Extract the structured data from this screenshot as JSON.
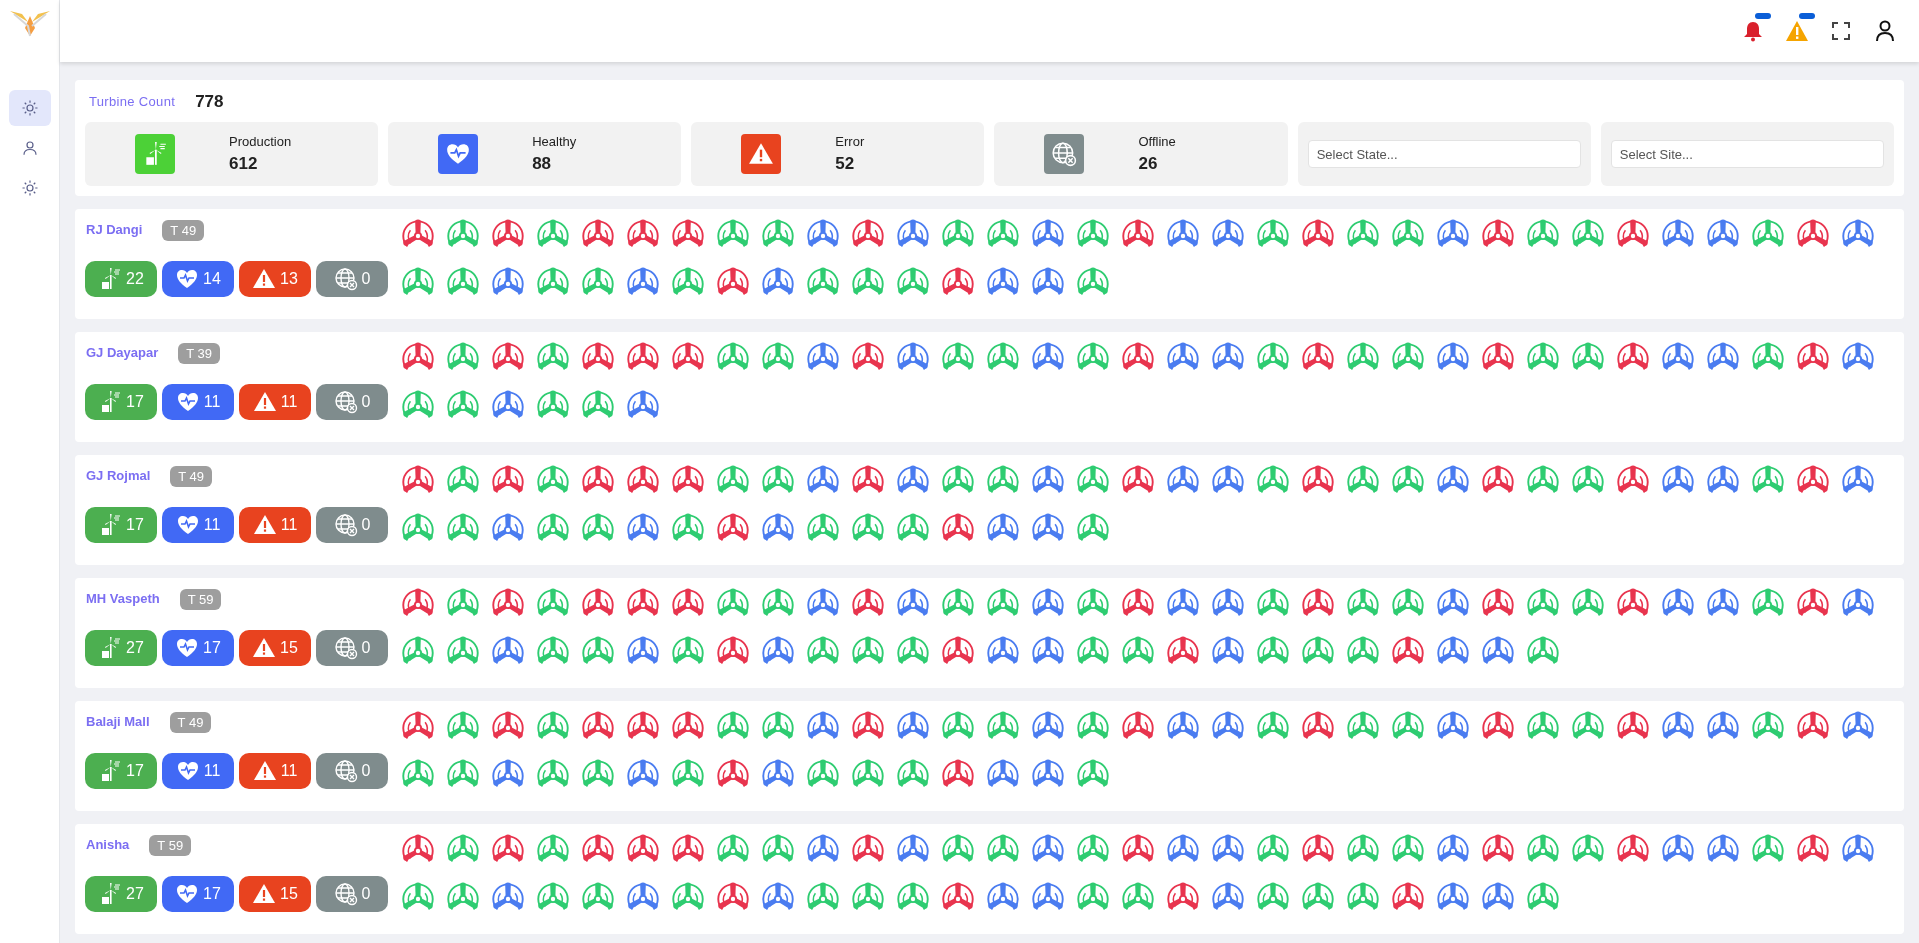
{
  "sidebar": {
    "items": [
      {
        "selected": true
      },
      {
        "selected": false
      },
      {
        "selected": false
      }
    ]
  },
  "summary": {
    "title": "Turbine Count",
    "total": "778",
    "stats": [
      {
        "kind": "production",
        "label": "Production",
        "value": "612"
      },
      {
        "kind": "healthy",
        "label": "Healthy",
        "value": "88"
      },
      {
        "kind": "error",
        "label": "Error",
        "value": "52"
      },
      {
        "kind": "offline",
        "label": "Offline",
        "value": "26"
      }
    ],
    "filters": [
      {
        "placeholder": "Select State..."
      },
      {
        "placeholder": "Select Site..."
      }
    ]
  },
  "sites": [
    {
      "name": "RJ Dangi",
      "count": "T 49",
      "badges": [
        {
          "kind": "production",
          "value": "22"
        },
        {
          "kind": "healthy",
          "value": "14"
        },
        {
          "kind": "error",
          "value": "13"
        },
        {
          "kind": "offline",
          "value": "0"
        }
      ],
      "turbines": [
        {
          "color": "#e8344e"
        },
        {
          "color": "#2ecc71"
        },
        {
          "color": "#e8344e"
        },
        {
          "color": "#2ecc71"
        },
        {
          "color": "#e8344e"
        },
        {
          "color": "#e8344e"
        },
        {
          "color": "#e8344e"
        },
        {
          "color": "#2ecc71"
        },
        {
          "color": "#2ecc71"
        },
        {
          "color": "#4a7cf0"
        },
        {
          "color": "#e8344e"
        },
        {
          "color": "#4a7cf0"
        },
        {
          "color": "#2ecc71"
        },
        {
          "color": "#2ecc71"
        },
        {
          "color": "#4a7cf0"
        },
        {
          "color": "#2ecc71"
        },
        {
          "color": "#e8344e"
        },
        {
          "color": "#4a7cf0"
        },
        {
          "color": "#4a7cf0"
        },
        {
          "color": "#2ecc71"
        },
        {
          "color": "#e8344e"
        },
        {
          "color": "#2ecc71"
        },
        {
          "color": "#2ecc71"
        },
        {
          "color": "#4a7cf0"
        },
        {
          "color": "#e8344e"
        },
        {
          "color": "#2ecc71"
        },
        {
          "color": "#2ecc71"
        },
        {
          "color": "#e8344e"
        },
        {
          "color": "#4a7cf0"
        },
        {
          "color": "#4a7cf0"
        },
        {
          "color": "#2ecc71"
        },
        {
          "color": "#e8344e"
        },
        {
          "color": "#4a7cf0"
        },
        {
          "color": "#2ecc71"
        },
        {
          "color": "#2ecc71"
        },
        {
          "color": "#4a7cf0"
        },
        {
          "color": "#2ecc71"
        },
        {
          "color": "#2ecc71"
        },
        {
          "color": "#4a7cf0"
        },
        {
          "color": "#2ecc71"
        },
        {
          "color": "#e8344e"
        },
        {
          "color": "#4a7cf0"
        },
        {
          "color": "#2ecc71"
        },
        {
          "color": "#2ecc71"
        },
        {
          "color": "#2ecc71"
        },
        {
          "color": "#e8344e"
        },
        {
          "color": "#4a7cf0"
        },
        {
          "color": "#4a7cf0"
        },
        {
          "color": "#2ecc71"
        }
      ]
    },
    {
      "name": "GJ Dayapar",
      "count": "T 39",
      "badges": [
        {
          "kind": "production",
          "value": "17"
        },
        {
          "kind": "healthy",
          "value": "11"
        },
        {
          "kind": "error",
          "value": "11"
        },
        {
          "kind": "offline",
          "value": "0"
        }
      ],
      "turbines": [
        {
          "color": "#e8344e"
        },
        {
          "color": "#2ecc71"
        },
        {
          "color": "#e8344e"
        },
        {
          "color": "#2ecc71"
        },
        {
          "color": "#e8344e"
        },
        {
          "color": "#e8344e"
        },
        {
          "color": "#e8344e"
        },
        {
          "color": "#2ecc71"
        },
        {
          "color": "#2ecc71"
        },
        {
          "color": "#4a7cf0"
        },
        {
          "color": "#e8344e"
        },
        {
          "color": "#4a7cf0"
        },
        {
          "color": "#2ecc71"
        },
        {
          "color": "#2ecc71"
        },
        {
          "color": "#4a7cf0"
        },
        {
          "color": "#2ecc71"
        },
        {
          "color": "#e8344e"
        },
        {
          "color": "#4a7cf0"
        },
        {
          "color": "#4a7cf0"
        },
        {
          "color": "#2ecc71"
        },
        {
          "color": "#e8344e"
        },
        {
          "color": "#2ecc71"
        },
        {
          "color": "#2ecc71"
        },
        {
          "color": "#4a7cf0"
        },
        {
          "color": "#e8344e"
        },
        {
          "color": "#2ecc71"
        },
        {
          "color": "#2ecc71"
        },
        {
          "color": "#e8344e"
        },
        {
          "color": "#4a7cf0"
        },
        {
          "color": "#4a7cf0"
        },
        {
          "color": "#2ecc71"
        },
        {
          "color": "#e8344e"
        },
        {
          "color": "#4a7cf0"
        },
        {
          "color": "#2ecc71"
        },
        {
          "color": "#2ecc71"
        },
        {
          "color": "#4a7cf0"
        },
        {
          "color": "#2ecc71"
        },
        {
          "color": "#2ecc71"
        },
        {
          "color": "#4a7cf0"
        }
      ]
    },
    {
      "name": "GJ Rojmal",
      "count": "T 49",
      "badges": [
        {
          "kind": "production",
          "value": "17"
        },
        {
          "kind": "healthy",
          "value": "11"
        },
        {
          "kind": "error",
          "value": "11"
        },
        {
          "kind": "offline",
          "value": "0"
        }
      ],
      "turbines": [
        {
          "color": "#e8344e"
        },
        {
          "color": "#2ecc71"
        },
        {
          "color": "#e8344e"
        },
        {
          "color": "#2ecc71"
        },
        {
          "color": "#e8344e"
        },
        {
          "color": "#e8344e"
        },
        {
          "color": "#e8344e"
        },
        {
          "color": "#2ecc71"
        },
        {
          "color": "#2ecc71"
        },
        {
          "color": "#4a7cf0"
        },
        {
          "color": "#e8344e"
        },
        {
          "color": "#4a7cf0"
        },
        {
          "color": "#2ecc71"
        },
        {
          "color": "#2ecc71"
        },
        {
          "color": "#4a7cf0"
        },
        {
          "color": "#2ecc71"
        },
        {
          "color": "#e8344e"
        },
        {
          "color": "#4a7cf0"
        },
        {
          "color": "#4a7cf0"
        },
        {
          "color": "#2ecc71"
        },
        {
          "color": "#e8344e"
        },
        {
          "color": "#2ecc71"
        },
        {
          "color": "#2ecc71"
        },
        {
          "color": "#4a7cf0"
        },
        {
          "color": "#e8344e"
        },
        {
          "color": "#2ecc71"
        },
        {
          "color": "#2ecc71"
        },
        {
          "color": "#e8344e"
        },
        {
          "color": "#4a7cf0"
        },
        {
          "color": "#4a7cf0"
        },
        {
          "color": "#2ecc71"
        },
        {
          "color": "#e8344e"
        },
        {
          "color": "#4a7cf0"
        },
        {
          "color": "#2ecc71"
        },
        {
          "color": "#2ecc71"
        },
        {
          "color": "#4a7cf0"
        },
        {
          "color": "#2ecc71"
        },
        {
          "color": "#2ecc71"
        },
        {
          "color": "#4a7cf0"
        },
        {
          "color": "#2ecc71"
        },
        {
          "color": "#e8344e"
        },
        {
          "color": "#4a7cf0"
        },
        {
          "color": "#2ecc71"
        },
        {
          "color": "#2ecc71"
        },
        {
          "color": "#2ecc71"
        },
        {
          "color": "#e8344e"
        },
        {
          "color": "#4a7cf0"
        },
        {
          "color": "#4a7cf0"
        },
        {
          "color": "#2ecc71"
        }
      ]
    },
    {
      "name": "MH Vaspeth",
      "count": "T 59",
      "badges": [
        {
          "kind": "production",
          "value": "27"
        },
        {
          "kind": "healthy",
          "value": "17"
        },
        {
          "kind": "error",
          "value": "15"
        },
        {
          "kind": "offline",
          "value": "0"
        }
      ],
      "turbines": [
        {
          "color": "#e8344e"
        },
        {
          "color": "#2ecc71"
        },
        {
          "color": "#e8344e"
        },
        {
          "color": "#2ecc71"
        },
        {
          "color": "#e8344e"
        },
        {
          "color": "#e8344e"
        },
        {
          "color": "#e8344e"
        },
        {
          "color": "#2ecc71"
        },
        {
          "color": "#2ecc71"
        },
        {
          "color": "#4a7cf0"
        },
        {
          "color": "#e8344e"
        },
        {
          "color": "#4a7cf0"
        },
        {
          "color": "#2ecc71"
        },
        {
          "color": "#2ecc71"
        },
        {
          "color": "#4a7cf0"
        },
        {
          "color": "#2ecc71"
        },
        {
          "color": "#e8344e"
        },
        {
          "color": "#4a7cf0"
        },
        {
          "color": "#4a7cf0"
        },
        {
          "color": "#2ecc71"
        },
        {
          "color": "#e8344e"
        },
        {
          "color": "#2ecc71"
        },
        {
          "color": "#2ecc71"
        },
        {
          "color": "#4a7cf0"
        },
        {
          "color": "#e8344e"
        },
        {
          "color": "#2ecc71"
        },
        {
          "color": "#2ecc71"
        },
        {
          "color": "#e8344e"
        },
        {
          "color": "#4a7cf0"
        },
        {
          "color": "#4a7cf0"
        },
        {
          "color": "#2ecc71"
        },
        {
          "color": "#e8344e"
        },
        {
          "color": "#4a7cf0"
        },
        {
          "color": "#2ecc71"
        },
        {
          "color": "#2ecc71"
        },
        {
          "color": "#4a7cf0"
        },
        {
          "color": "#2ecc71"
        },
        {
          "color": "#2ecc71"
        },
        {
          "color": "#4a7cf0"
        },
        {
          "color": "#2ecc71"
        },
        {
          "color": "#e8344e"
        },
        {
          "color": "#4a7cf0"
        },
        {
          "color": "#2ecc71"
        },
        {
          "color": "#2ecc71"
        },
        {
          "color": "#2ecc71"
        },
        {
          "color": "#e8344e"
        },
        {
          "color": "#4a7cf0"
        },
        {
          "color": "#4a7cf0"
        },
        {
          "color": "#2ecc71"
        },
        {
          "color": "#2ecc71"
        },
        {
          "color": "#e8344e"
        },
        {
          "color": "#4a7cf0"
        },
        {
          "color": "#2ecc71"
        },
        {
          "color": "#2ecc71"
        },
        {
          "color": "#2ecc71"
        },
        {
          "color": "#e8344e"
        },
        {
          "color": "#4a7cf0"
        },
        {
          "color": "#4a7cf0"
        },
        {
          "color": "#2ecc71"
        }
      ]
    },
    {
      "name": "Balaji Mall",
      "count": "T 49",
      "badges": [
        {
          "kind": "production",
          "value": "17"
        },
        {
          "kind": "healthy",
          "value": "11"
        },
        {
          "kind": "error",
          "value": "11"
        },
        {
          "kind": "offline",
          "value": "0"
        }
      ],
      "turbines": [
        {
          "color": "#e8344e"
        },
        {
          "color": "#2ecc71"
        },
        {
          "color": "#e8344e"
        },
        {
          "color": "#2ecc71"
        },
        {
          "color": "#e8344e"
        },
        {
          "color": "#e8344e"
        },
        {
          "color": "#e8344e"
        },
        {
          "color": "#2ecc71"
        },
        {
          "color": "#2ecc71"
        },
        {
          "color": "#4a7cf0"
        },
        {
          "color": "#e8344e"
        },
        {
          "color": "#4a7cf0"
        },
        {
          "color": "#2ecc71"
        },
        {
          "color": "#2ecc71"
        },
        {
          "color": "#4a7cf0"
        },
        {
          "color": "#2ecc71"
        },
        {
          "color": "#e8344e"
        },
        {
          "color": "#4a7cf0"
        },
        {
          "color": "#4a7cf0"
        },
        {
          "color": "#2ecc71"
        },
        {
          "color": "#e8344e"
        },
        {
          "color": "#2ecc71"
        },
        {
          "color": "#2ecc71"
        },
        {
          "color": "#4a7cf0"
        },
        {
          "color": "#e8344e"
        },
        {
          "color": "#2ecc71"
        },
        {
          "color": "#2ecc71"
        },
        {
          "color": "#e8344e"
        },
        {
          "color": "#4a7cf0"
        },
        {
          "color": "#4a7cf0"
        },
        {
          "color": "#2ecc71"
        },
        {
          "color": "#e8344e"
        },
        {
          "color": "#4a7cf0"
        },
        {
          "color": "#2ecc71"
        },
        {
          "color": "#2ecc71"
        },
        {
          "color": "#4a7cf0"
        },
        {
          "color": "#2ecc71"
        },
        {
          "color": "#2ecc71"
        },
        {
          "color": "#4a7cf0"
        },
        {
          "color": "#2ecc71"
        },
        {
          "color": "#e8344e"
        },
        {
          "color": "#4a7cf0"
        },
        {
          "color": "#2ecc71"
        },
        {
          "color": "#2ecc71"
        },
        {
          "color": "#2ecc71"
        },
        {
          "color": "#e8344e"
        },
        {
          "color": "#4a7cf0"
        },
        {
          "color": "#4a7cf0"
        },
        {
          "color": "#2ecc71"
        }
      ]
    },
    {
      "name": "Anisha",
      "count": "T 59",
      "badges": [
        {
          "kind": "production",
          "value": "27"
        },
        {
          "kind": "healthy",
          "value": "17"
        },
        {
          "kind": "error",
          "value": "15"
        },
        {
          "kind": "offline",
          "value": "0"
        }
      ],
      "turbines": [
        {
          "color": "#e8344e"
        },
        {
          "color": "#2ecc71"
        },
        {
          "color": "#e8344e"
        },
        {
          "color": "#2ecc71"
        },
        {
          "color": "#e8344e"
        },
        {
          "color": "#e8344e"
        },
        {
          "color": "#e8344e"
        },
        {
          "color": "#2ecc71"
        },
        {
          "color": "#2ecc71"
        },
        {
          "color": "#4a7cf0"
        },
        {
          "color": "#e8344e"
        },
        {
          "color": "#4a7cf0"
        },
        {
          "color": "#2ecc71"
        },
        {
          "color": "#2ecc71"
        },
        {
          "color": "#4a7cf0"
        },
        {
          "color": "#2ecc71"
        },
        {
          "color": "#e8344e"
        },
        {
          "color": "#4a7cf0"
        },
        {
          "color": "#4a7cf0"
        },
        {
          "color": "#2ecc71"
        },
        {
          "color": "#e8344e"
        },
        {
          "color": "#2ecc71"
        },
        {
          "color": "#2ecc71"
        },
        {
          "color": "#4a7cf0"
        },
        {
          "color": "#e8344e"
        },
        {
          "color": "#2ecc71"
        },
        {
          "color": "#2ecc71"
        },
        {
          "color": "#e8344e"
        },
        {
          "color": "#4a7cf0"
        },
        {
          "color": "#4a7cf0"
        },
        {
          "color": "#2ecc71"
        },
        {
          "color": "#e8344e"
        },
        {
          "color": "#4a7cf0"
        },
        {
          "color": "#2ecc71"
        },
        {
          "color": "#2ecc71"
        },
        {
          "color": "#4a7cf0"
        },
        {
          "color": "#2ecc71"
        },
        {
          "color": "#2ecc71"
        },
        {
          "color": "#4a7cf0"
        },
        {
          "color": "#2ecc71"
        },
        {
          "color": "#e8344e"
        },
        {
          "color": "#4a7cf0"
        },
        {
          "color": "#2ecc71"
        },
        {
          "color": "#2ecc71"
        },
        {
          "color": "#2ecc71"
        },
        {
          "color": "#e8344e"
        },
        {
          "color": "#4a7cf0"
        },
        {
          "color": "#4a7cf0"
        },
        {
          "color": "#2ecc71"
        },
        {
          "color": "#2ecc71"
        },
        {
          "color": "#e8344e"
        },
        {
          "color": "#4a7cf0"
        },
        {
          "color": "#2ecc71"
        },
        {
          "color": "#2ecc71"
        },
        {
          "color": "#2ecc71"
        },
        {
          "color": "#e8344e"
        },
        {
          "color": "#4a7cf0"
        },
        {
          "color": "#4a7cf0"
        },
        {
          "color": "#2ecc71"
        }
      ]
    }
  ]
}
